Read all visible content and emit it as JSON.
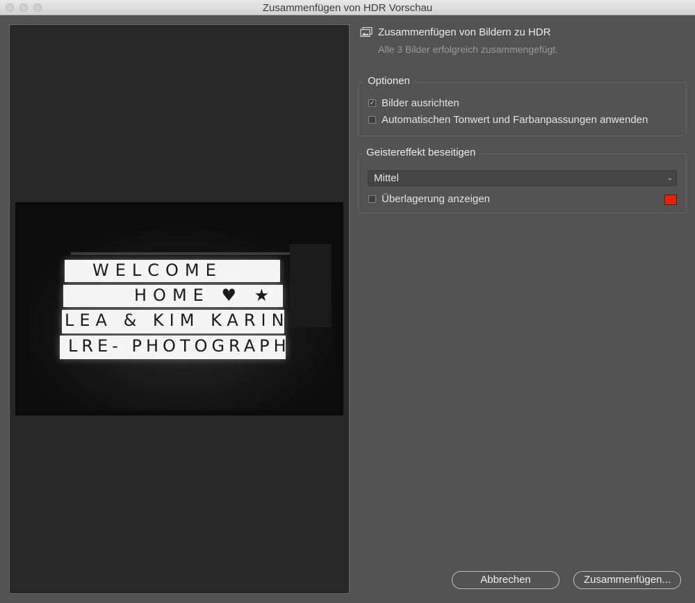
{
  "window": {
    "title": "Zusammenfügen von HDR Vorschau"
  },
  "preview": {
    "sign_lines": [
      "WELCOME",
      "HOME ♥ ★",
      "LEA & KIM KARIN",
      "LRE- PHOTOGRAPHY"
    ]
  },
  "header": {
    "title": "Zusammenfügen von Bildern zu HDR",
    "status": "Alle 3 Bilder erfolgreich zusammengefügt."
  },
  "options": {
    "label": "Optionen",
    "align_label": "Bilder ausrichten",
    "align_checked": true,
    "auto_tone_label": "Automatischen Tonwert und Farbanpassungen anwenden",
    "auto_tone_checked": false
  },
  "deghost": {
    "label": "Geistereffekt beseitigen",
    "selected": "Mittel",
    "overlay_label": "Überlagerung anzeigen",
    "overlay_checked": false,
    "overlay_color": "#e8230c"
  },
  "buttons": {
    "cancel": "Abbrechen",
    "merge": "Zusammenfügen..."
  }
}
